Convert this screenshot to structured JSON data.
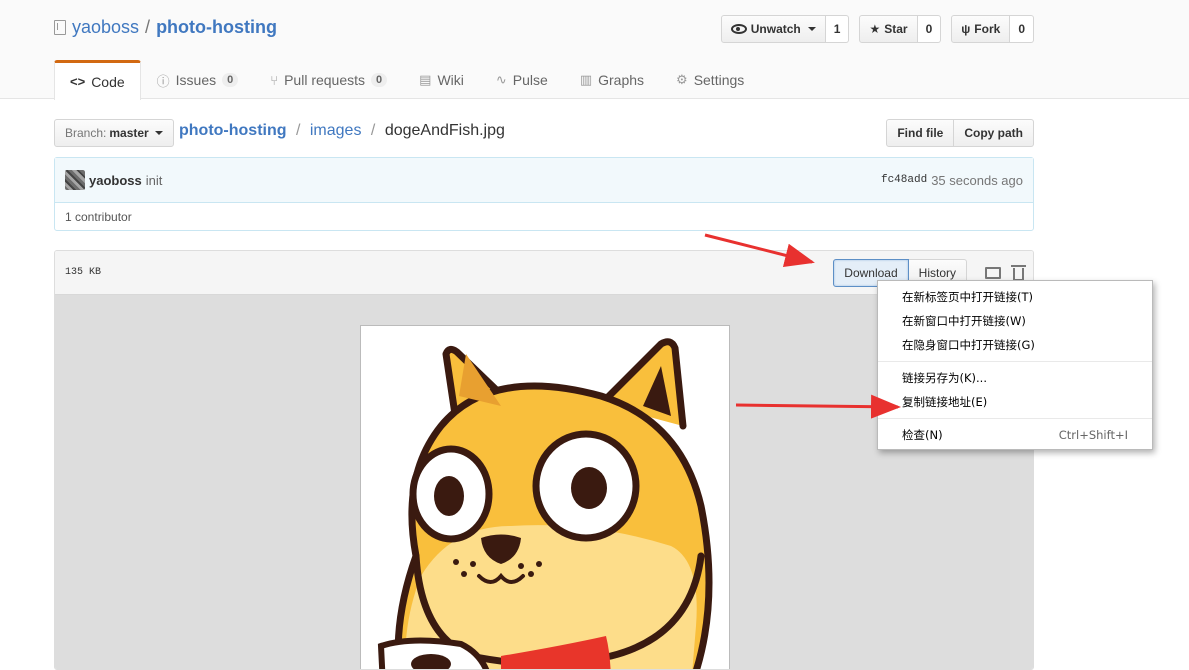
{
  "repo": {
    "owner": "yaoboss",
    "separator": "/",
    "name": "photo-hosting"
  },
  "actions": {
    "watch_label": "Unwatch",
    "watch_count": "1",
    "star_label": "Star",
    "star_count": "0",
    "fork_label": "Fork",
    "fork_count": "0"
  },
  "nav": {
    "code": "Code",
    "issues": "Issues",
    "issues_count": "0",
    "pulls": "Pull requests",
    "pulls_count": "0",
    "wiki": "Wiki",
    "pulse": "Pulse",
    "graphs": "Graphs",
    "settings": "Settings"
  },
  "file_nav": {
    "branch_label": "Branch:",
    "branch_value": "master",
    "crumb_root": "photo-hosting",
    "crumb_dir": "images",
    "crumb_file": "dogeAndFish.jpg",
    "sep": "/",
    "find_file": "Find file",
    "copy_path": "Copy path"
  },
  "commit": {
    "author": "yaoboss",
    "message": "init",
    "sha": "fc48add",
    "time": "35 seconds ago",
    "contributors": "1 contributor"
  },
  "file": {
    "size": "135 KB",
    "download": "Download",
    "history": "History"
  },
  "context_menu": {
    "items": [
      "在新标签页中打开链接(T)",
      "在新窗口中打开链接(W)",
      "在隐身窗口中打开链接(G)",
      "链接另存为(K)...",
      "复制链接地址(E)",
      "检查(N)"
    ],
    "inspect_shortcut": "Ctrl+Shift+I"
  },
  "colors": {
    "accent_link": "#4078c0",
    "tab_accent": "#d26911",
    "annotation_arrow": "#e8312f",
    "doge_body": "#f9bf3c",
    "doge_outline": "#3a1a10"
  },
  "icons": [
    "repo-icon",
    "eye-icon",
    "star-icon",
    "fork-icon",
    "code-icon",
    "issue-icon",
    "pull-request-icon",
    "wiki-icon",
    "pulse-icon",
    "graph-icon",
    "gear-icon",
    "desktop-icon",
    "trash-icon"
  ]
}
